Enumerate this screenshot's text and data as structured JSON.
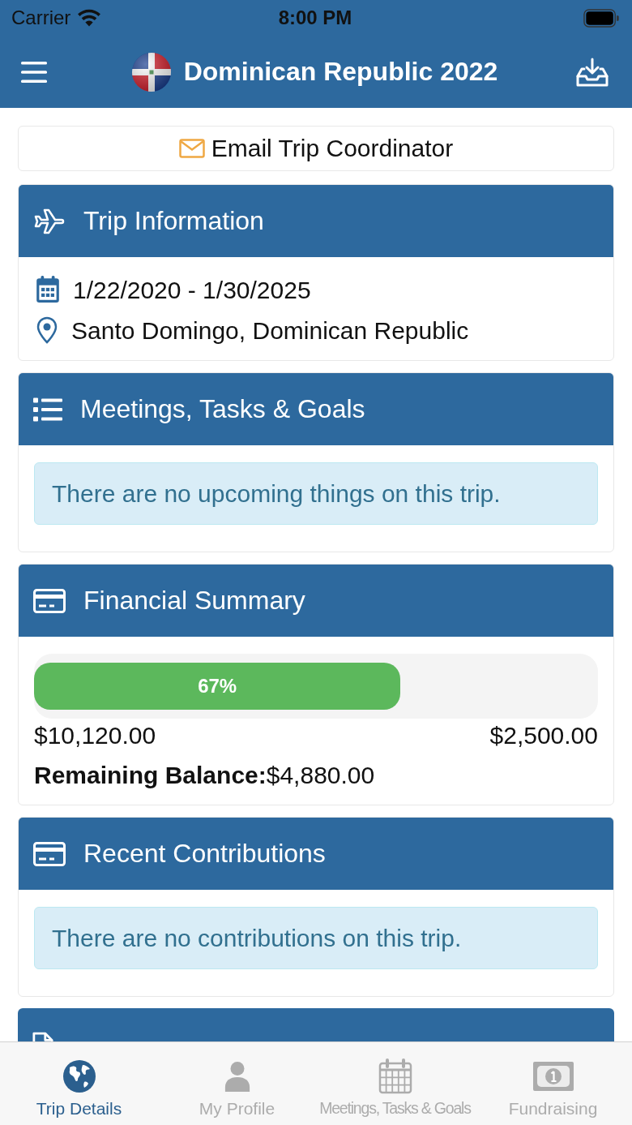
{
  "status_bar": {
    "carrier": "Carrier",
    "time": "8:00 PM"
  },
  "nav_bar": {
    "title": "Dominican Republic 2022"
  },
  "email_button": {
    "label": "Email Trip Coordinator"
  },
  "sections": [
    {
      "kind": "details",
      "title": "Trip Information",
      "rows": [
        {
          "kind": "dates",
          "text": "1/22/2020 - 1/30/2025"
        },
        {
          "kind": "location",
          "text": "Santo Domingo, Dominican Republic"
        }
      ]
    },
    {
      "kind": "notice",
      "title": "Meetings, Tasks & Goals",
      "message": "There are no upcoming things on this trip."
    },
    {
      "kind": "finance",
      "title": "Financial Summary",
      "progress": {
        "level": 0.65,
        "label": "67%"
      },
      "amount_left": "$10,120.00",
      "amount_right": "$2,500.00",
      "remaining": {
        "label": "Remaining Balance:",
        "value": "$4,880.00"
      }
    },
    {
      "kind": "notice",
      "title": "Recent Contributions",
      "message": "There are no contributions on this trip."
    },
    {
      "kind": "heading_only"
    }
  ],
  "tab_bar": [
    {
      "label": "Trip Details",
      "selected": true
    },
    {
      "label": "My Profile",
      "selected": false
    },
    {
      "label": "Meetings, Tasks & Goals",
      "selected": false
    },
    {
      "label": "Fundraising",
      "selected": false
    }
  ]
}
